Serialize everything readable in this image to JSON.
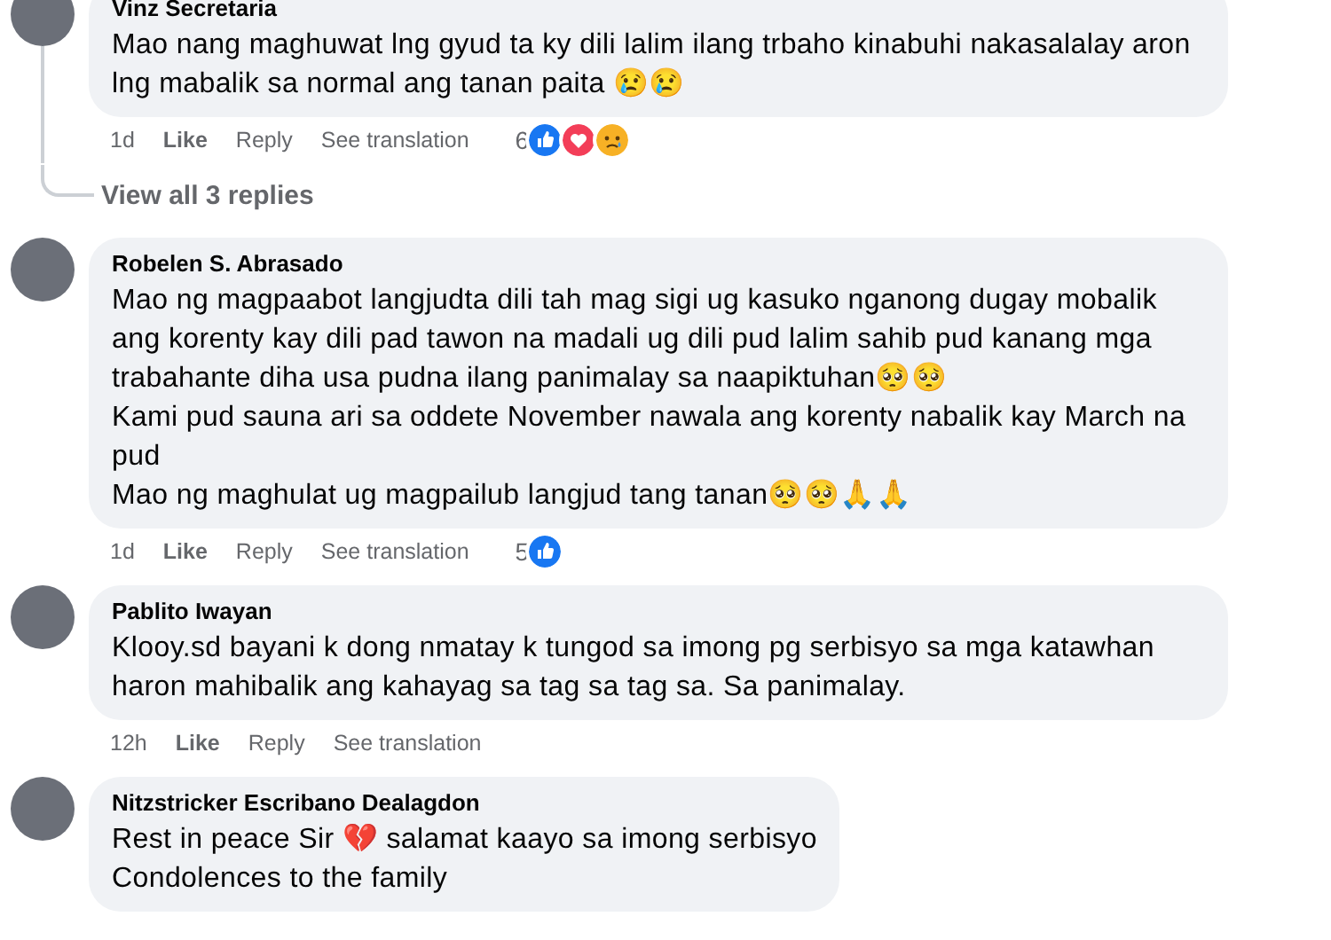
{
  "comments": [
    {
      "author": "Vinz Secretaria",
      "paragraphs": [
        "Mao nang maghuwat lng gyud ta ky dili lalim ilang trbaho kinabuhi nakasalalay aron lng mabalik sa normal ang tanan paita 😢😢"
      ],
      "time": "1d",
      "actions": [
        "Like",
        "Reply",
        "See translation"
      ],
      "reaction_count": "6",
      "reactions": [
        {
          "kind": "like"
        },
        {
          "kind": "love"
        },
        {
          "kind": "sad"
        }
      ],
      "replies_link": "View all 3 replies"
    },
    {
      "author": "Robelen S. Abrasado",
      "paragraphs": [
        "Mao ng magpaabot langjudta dili tah mag sigi ug kasuko nganong dugay mobalik ang korenty kay dili pad tawon na madali ug dili pud lalim sahib pud kanang mga trabahante diha usa pudna ilang panimalay sa naapiktuhan🥺🥺",
        "Kami pud sauna ari sa oddete November nawala ang korenty nabalik kay March na pud",
        "Mao ng maghulat ug magpailub langjud tang tanan🥺🥺🙏🙏"
      ],
      "time": "1d",
      "actions": [
        "Like",
        "Reply",
        "See translation"
      ],
      "reaction_count": "5",
      "reactions": [
        {
          "kind": "like"
        }
      ]
    },
    {
      "author": "Pablito Iwayan",
      "paragraphs": [
        "Klooy.sd bayani k dong nmatay k tungod sa imong pg serbisyo sa mga katawhan haron mahibalik ang kahayag sa tag sa tag sa. Sa panimalay."
      ],
      "time": "12h",
      "actions": [
        "Like",
        "Reply",
        "See translation"
      ]
    },
    {
      "author": "Nitzstricker Escribano Dealagdon",
      "paragraphs": [
        "Rest in peace Sir 💔 salamat kaayo sa imong serbisyo",
        "Condolences to the family"
      ]
    }
  ]
}
